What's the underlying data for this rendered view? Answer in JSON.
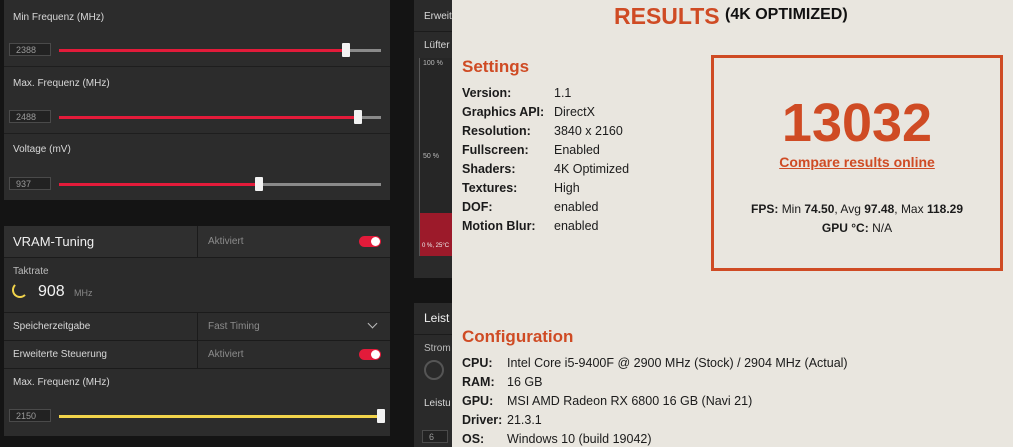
{
  "gpu_tuning": {
    "min_freq_label": "Min Frequenz (MHz)",
    "min_freq_value": "2388",
    "max_freq_label": "Max. Frequenz (MHz)",
    "max_freq_value": "2488",
    "voltage_label": "Voltage (mV)",
    "voltage_value": "937",
    "min_freq_level": 0.89,
    "max_freq_level": 0.93,
    "voltage_level": 0.62
  },
  "vram": {
    "title": "VRAM-Tuning",
    "status": "Aktiviert",
    "clock_label": "Taktrate",
    "clock_value": "908",
    "clock_unit": "MHz",
    "timing_label": "Speicherzeitgabe",
    "timing_value": "Fast Timing",
    "advanced_label": "Erweiterte Steuerung",
    "advanced_status": "Aktiviert",
    "max_freq_label": "Max. Frequenz (MHz)",
    "max_freq_value": "2150",
    "max_freq_level": 1.0
  },
  "middle": {
    "top_label": "Erweit",
    "fan_label": "Lüfter",
    "pct_100": "100 %",
    "pct_50": "50 %",
    "fan_tag": "0 %, 25°C",
    "power_label": "Leist",
    "power_sub": "Strom",
    "power_limit_label": "Leistu",
    "power_value": "6"
  },
  "results": {
    "title": "RESULTS",
    "subtitle": "(4K OPTIMIZED)",
    "settings_header": "Settings",
    "settings": [
      {
        "key": "Version:",
        "value": "1.1"
      },
      {
        "key": "Graphics API:",
        "value": "DirectX"
      },
      {
        "key": "Resolution:",
        "value": "3840 x 2160"
      },
      {
        "key": "Fullscreen:",
        "value": "Enabled"
      },
      {
        "key": "Shaders:",
        "value": "4K Optimized"
      },
      {
        "key": "Textures:",
        "value": "High"
      },
      {
        "key": "DOF:",
        "value": "enabled"
      },
      {
        "key": "Motion Blur:",
        "value": "enabled"
      }
    ],
    "score": "13032",
    "compare_link": "Compare results online",
    "fps_label": "FPS:",
    "fps_min_label": "Min",
    "fps_min": "74.50",
    "fps_avg_label": "Avg",
    "fps_avg": "97.48",
    "fps_max_label": "Max",
    "fps_max": "118.29",
    "gpu_temp_label": "GPU °C:",
    "gpu_temp_value": "N/A",
    "config_header": "Configuration",
    "config": [
      {
        "key": "CPU:",
        "value": "Intel Core i5-9400F @ 2900 MHz (Stock) / 2904 MHz (Actual)"
      },
      {
        "key": "RAM:",
        "value": "16 GB"
      },
      {
        "key": "GPU:",
        "value": "MSI AMD Radeon RX 6800 16 GB (Navi 21)"
      },
      {
        "key": "Driver:",
        "value": "21.3.1"
      },
      {
        "key": "OS:",
        "value": "Windows 10 (build 19042)"
      }
    ],
    "accent": "#cf4b24"
  },
  "colors": {
    "red": "#e31b3a",
    "yellow": "#f2d44b"
  }
}
